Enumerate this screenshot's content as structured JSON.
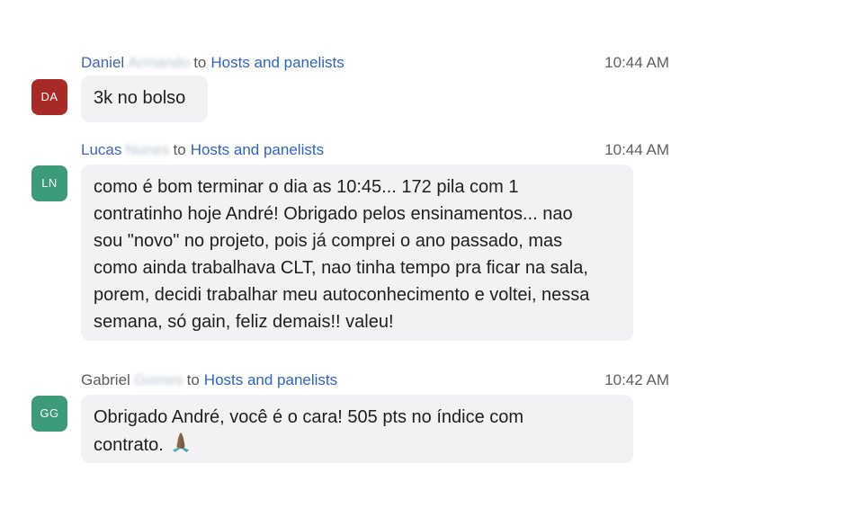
{
  "messages": [
    {
      "sender_first": "Daniel",
      "sender_surname_blurred": "Armando",
      "to_word": "to",
      "recipient": "Hosts and panelists",
      "time": "10:44 AM",
      "avatar_initials": "DA",
      "avatar_color": "#a82a27",
      "sender_color": "#3b66b8",
      "text": "3k no bolso"
    },
    {
      "sender_first": "Lucas",
      "sender_surname_blurred": "Nunes",
      "to_word": "to",
      "recipient": "Hosts and panelists",
      "time": "10:44 AM",
      "avatar_initials": "LN",
      "avatar_color": "#3c9b78",
      "sender_color": "#3b66b8",
      "text": "como é bom terminar o dia as 10:45... 172 pila com 1\ncontratinho hoje André! Obrigado pelos ensinamentos... nao\nsou \"novo\" no projeto, pois já comprei o ano passado, mas\ncomo ainda trabalhava CLT, nao tinha tempo pra ficar na sala,\nporem, decidi trabalhar meu autoconhecimento e voltei, nessa\nsemana, só gain, feliz demais!! valeu!"
    },
    {
      "sender_first": "Gabriel",
      "sender_surname_blurred": "Gomes",
      "to_word": "to",
      "recipient": "Hosts and panelists",
      "time": "10:42 AM",
      "avatar_initials": "GG",
      "avatar_color": "#3c9b78",
      "sender_color": "#5b5b5b",
      "text": "Obrigado André, você é o cara! 505 pts no índice com\ncontrato.",
      "emoji": "folded-hands-icon"
    }
  ]
}
